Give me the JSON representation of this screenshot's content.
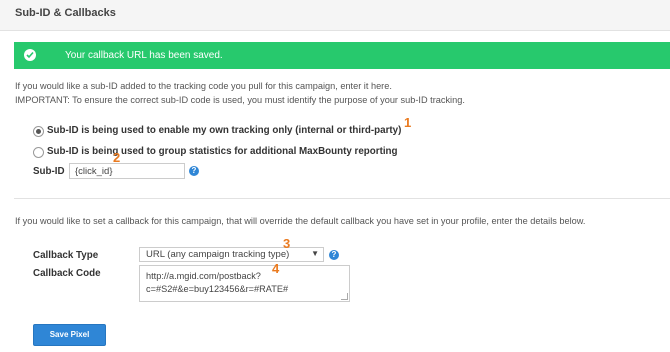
{
  "header": {
    "title": "Sub-ID & Callbacks"
  },
  "alert": {
    "icon": "check-circle-icon",
    "message": "Your callback URL has been saved.",
    "color": "#27c96d"
  },
  "subid": {
    "intro_line1": "If you would like a sub-ID added to the tracking code you pull for this campaign, enter it here.",
    "intro_line2": "IMPORTANT: To ensure the correct sub-ID code is used, you must identify the purpose of your sub-ID tracking.",
    "options": [
      {
        "label": "Sub-ID is being used to enable my own tracking only (internal or third-party)",
        "selected": true
      },
      {
        "label": "Sub-ID is being used to group statistics for additional MaxBounty reporting",
        "selected": false
      }
    ],
    "field_label": "Sub-ID",
    "field_value": "{click_id}"
  },
  "callback": {
    "intro": "If you would like to set a callback for this campaign, that will override the default callback you have set in your profile, enter the details below.",
    "type_label": "Callback Type",
    "type_value": "URL (any campaign tracking type)",
    "code_label": "Callback Code",
    "code_line1": "http://a.mgid.com/postback?",
    "code_line2": "c=#S2#&e=buy123456&r=#RATE#"
  },
  "save_button": "Save Pixel",
  "annotations": [
    "1",
    "2",
    "3",
    "4"
  ],
  "colors": {
    "accent": "#2f86d6",
    "annotation": "#ea7a1f"
  }
}
